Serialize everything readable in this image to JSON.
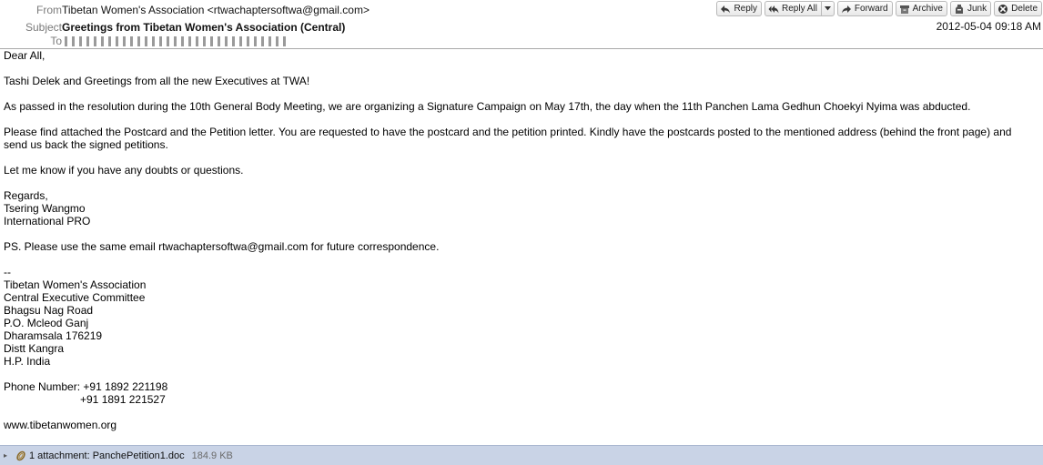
{
  "header": {
    "from_label": "From",
    "from_value": "Tibetan Women's Association <rtwachaptersoftwa@gmail.com>",
    "subject_label": "Subject",
    "subject_value": "Greetings from Tibetan Women's Association (Central)",
    "to_label": "To",
    "date": "2012-05-04 09:18 AM"
  },
  "toolbar": {
    "reply": "Reply",
    "reply_all": "Reply All",
    "forward": "Forward",
    "archive": "Archive",
    "junk": "Junk",
    "delete": "Delete"
  },
  "body": {
    "greeting": "Dear All,",
    "line1": "Tashi Delek and Greetings from all the new Executives at TWA!",
    "line2": "As passed in the resolution during the 10th General Body Meeting, we are organizing a Signature Campaign on May 17th, the day when the 11th Panchen Lama Gedhun Choekyi Nyima was abducted.",
    "line3a": "Please find attached the Postcard and the Petition letter. You are requested to have the postcard and the petition printed. Kindly have the postcards posted to the mentioned address (behind the front page) and",
    "line3b": "send us back the signed petitions.",
    "line4": "Let me know if you have any doubts or questions.",
    "regards": "Regards,",
    "name": "Tsering Wangmo",
    "role": "International PRO",
    "ps": "PS. Please use the same email rtwachaptersoftwa@gmail.com for future correspondence.",
    "sig_sep": "--",
    "sig_lines": [
      "Tibetan Women's Association",
      "Central Executive Committee",
      "Bhagsu Nag Road",
      "P.O. Mcleod Ganj",
      "Dharamsala 176219",
      "Distt Kangra",
      "H.P. India"
    ],
    "phone1": "Phone Number: +91 1892 221198",
    "phone2": "+91 1891 221527",
    "website": "www.tibetanwomen.org"
  },
  "attachment": {
    "label": "1 attachment: PanchePetition1.doc",
    "size": "184.9 KB"
  },
  "icons": [
    "reply-icon",
    "reply-all-icon",
    "forward-icon",
    "archive-icon",
    "junk-icon",
    "delete-icon",
    "paperclip-icon",
    "expand-twisty-icon"
  ]
}
